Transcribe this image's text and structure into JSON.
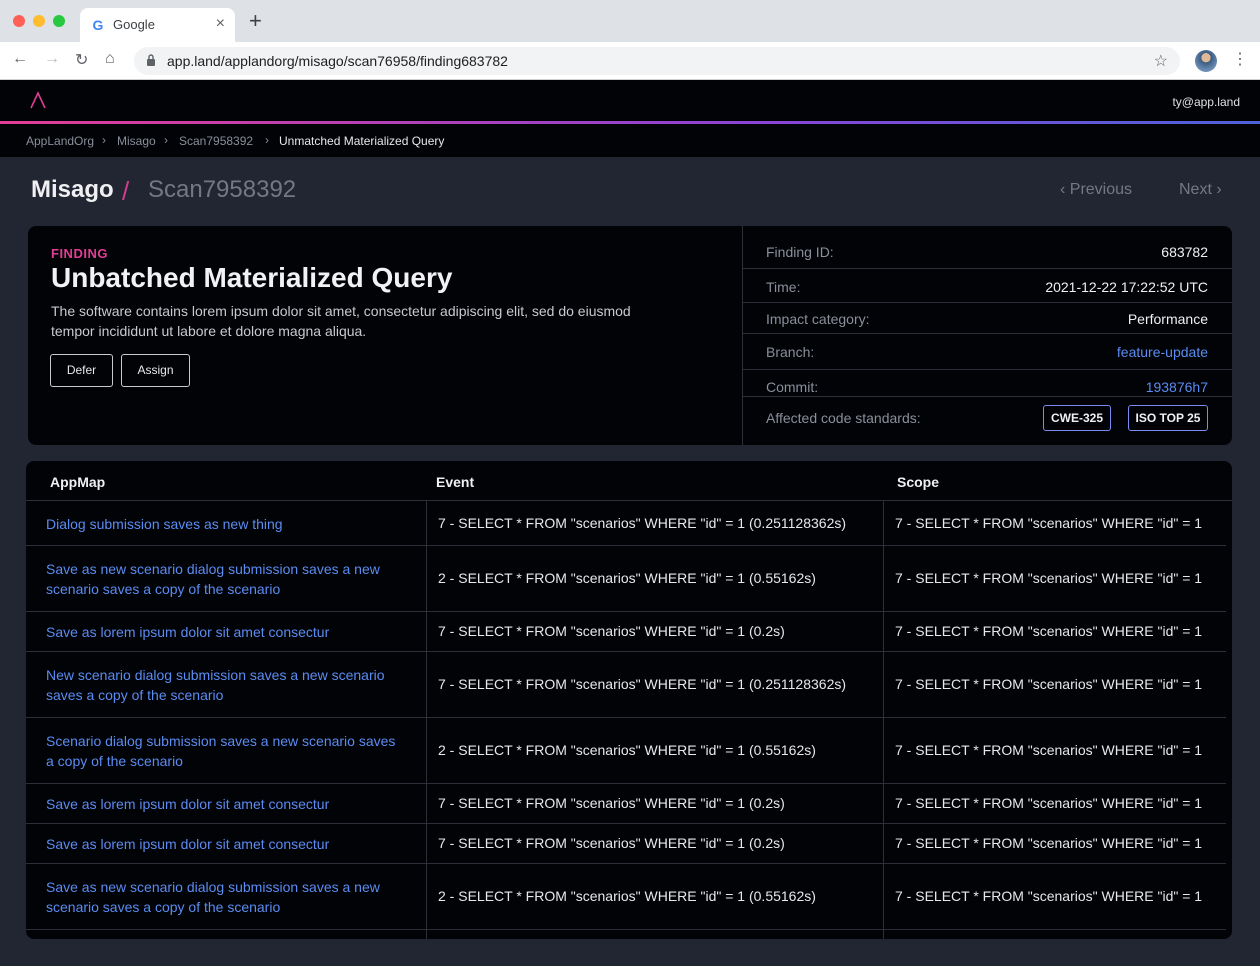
{
  "browser": {
    "tab_title": "Google",
    "favicon": "G",
    "url": "app.land/applandorg/misago/scan76958/finding683782"
  },
  "header": {
    "user_email": "ty@app.land"
  },
  "breadcrumb": [
    "AppLandOrg",
    "Misago",
    "Scan7958392",
    "Unmatched Materialized Query"
  ],
  "page": {
    "project": "Misago",
    "scan": "Scan7958392",
    "previous": "Previous",
    "next": "Next"
  },
  "finding": {
    "label": "FINDING",
    "title": "Unbatched Materialized Query",
    "description": "The software contains lorem ipsum dolor sit amet, consectetur adipiscing elit, sed do eiusmod tempor incididunt ut labore et dolore magna aliqua.",
    "defer_label": "Defer",
    "assign_label": "Assign"
  },
  "meta": {
    "finding_id_label": "Finding ID:",
    "finding_id": "683782",
    "time_label": "Time:",
    "time": "2021-12-22 17:22:52 UTC",
    "impact_label": "Impact category:",
    "impact": "Performance",
    "branch_label": "Branch:",
    "branch": "feature-update",
    "commit_label": "Commit:",
    "commit": "193876h7",
    "standards_label": "Affected code standards:",
    "standards": [
      "CWE-325",
      "ISO TOP 25"
    ]
  },
  "table": {
    "headers": [
      "AppMap",
      "Event",
      "Scope"
    ],
    "rows": [
      {
        "appmap": "Dialog submission saves as new thing",
        "event": "7 - SELECT * FROM \"scenarios\" WHERE \"id\" = 1 (0.251128362s)",
        "scope": "7 - SELECT * FROM \"scenarios\" WHERE \"id\" = 1"
      },
      {
        "appmap": "Save as new scenario dialog submission saves a new scenario saves a copy of the scenario",
        "event": "2 - SELECT * FROM \"scenarios\" WHERE \"id\" = 1 (0.55162s)",
        "scope": "7 - SELECT * FROM \"scenarios\" WHERE \"id\" = 1"
      },
      {
        "appmap": "Save as lorem ipsum dolor sit amet consectur",
        "event": "7 - SELECT * FROM \"scenarios\" WHERE \"id\" = 1 (0.2s)",
        "scope": "7 - SELECT * FROM \"scenarios\" WHERE \"id\" = 1"
      },
      {
        "appmap": "New scenario dialog submission saves a new scenario saves a copy of the scenario",
        "event": "7 - SELECT * FROM \"scenarios\" WHERE \"id\" = 1 (0.251128362s)",
        "scope": "7 - SELECT * FROM \"scenarios\" WHERE \"id\" = 1"
      },
      {
        "appmap": "Scenario dialog submission saves a new scenario saves a copy of the scenario",
        "event": "2 - SELECT * FROM \"scenarios\" WHERE \"id\" = 1 (0.55162s)",
        "scope": "7 - SELECT * FROM \"scenarios\" WHERE \"id\" = 1"
      },
      {
        "appmap": "Save as lorem ipsum dolor sit amet consectur",
        "event": "7 - SELECT * FROM \"scenarios\" WHERE \"id\" = 1 (0.2s)",
        "scope": "7 - SELECT * FROM \"scenarios\" WHERE \"id\" = 1"
      },
      {
        "appmap": "Save as lorem ipsum dolor sit amet consectur",
        "event": "7 - SELECT * FROM \"scenarios\" WHERE \"id\" = 1 (0.2s)",
        "scope": "7 - SELECT * FROM \"scenarios\" WHERE \"id\" = 1"
      },
      {
        "appmap": "Save as new scenario dialog submission saves a new scenario saves a copy of the scenario",
        "event": "2 - SELECT * FROM \"scenarios\" WHERE \"id\" = 1 (0.55162s)",
        "scope": "7 - SELECT * FROM \"scenarios\" WHERE \"id\" = 1"
      }
    ]
  },
  "colors": {
    "accent": "#e23d96",
    "link": "#5b8cf2",
    "background": "#222633",
    "card": "#010306"
  }
}
